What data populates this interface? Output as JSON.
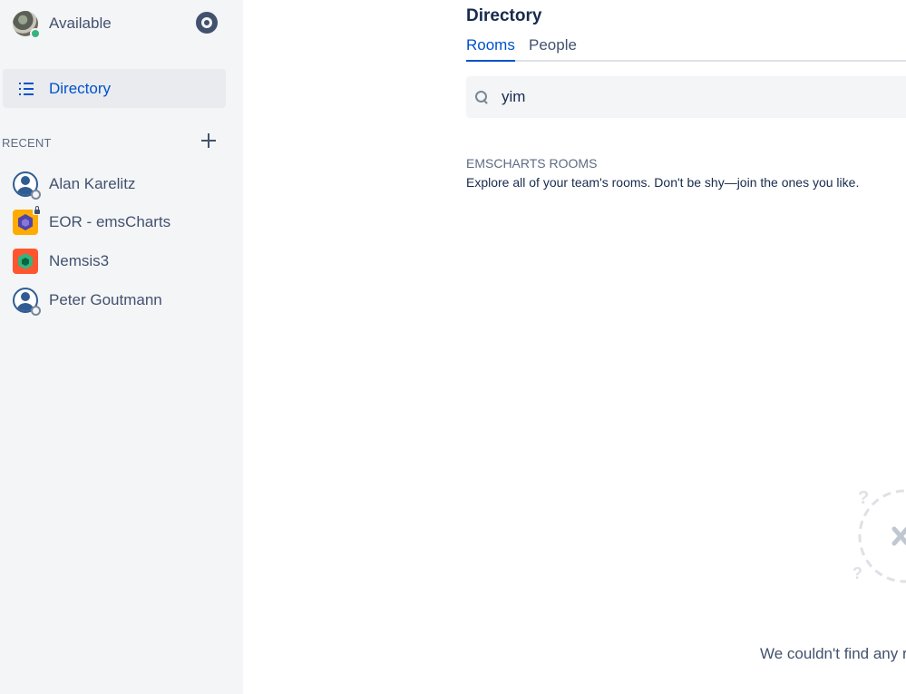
{
  "sidebar": {
    "status": {
      "label": "Available",
      "presence_color": "#36b37e"
    },
    "nav": {
      "directory_label": "Directory"
    },
    "recent": {
      "heading": "RECENT",
      "items": [
        {
          "label": "Alan Karelitz",
          "type": "person"
        },
        {
          "label": "EOR - emsCharts",
          "type": "room-private"
        },
        {
          "label": "Nemsis3",
          "type": "room"
        },
        {
          "label": "Peter Goutmann",
          "type": "person"
        }
      ]
    }
  },
  "main": {
    "title": "Directory",
    "tabs": [
      {
        "label": "Rooms",
        "active": true
      },
      {
        "label": "People",
        "active": false
      }
    ],
    "search": {
      "value": "yim"
    },
    "section": {
      "heading": "EMSCHARTS ROOMS",
      "description": "Explore all of your team's rooms. Don't be shy—join the ones you like."
    },
    "empty_state": {
      "message": "We couldn't find any r"
    }
  },
  "colors": {
    "accent": "#0052cc",
    "sidebar_bg": "#f4f5f7",
    "text": "#172b4d"
  }
}
